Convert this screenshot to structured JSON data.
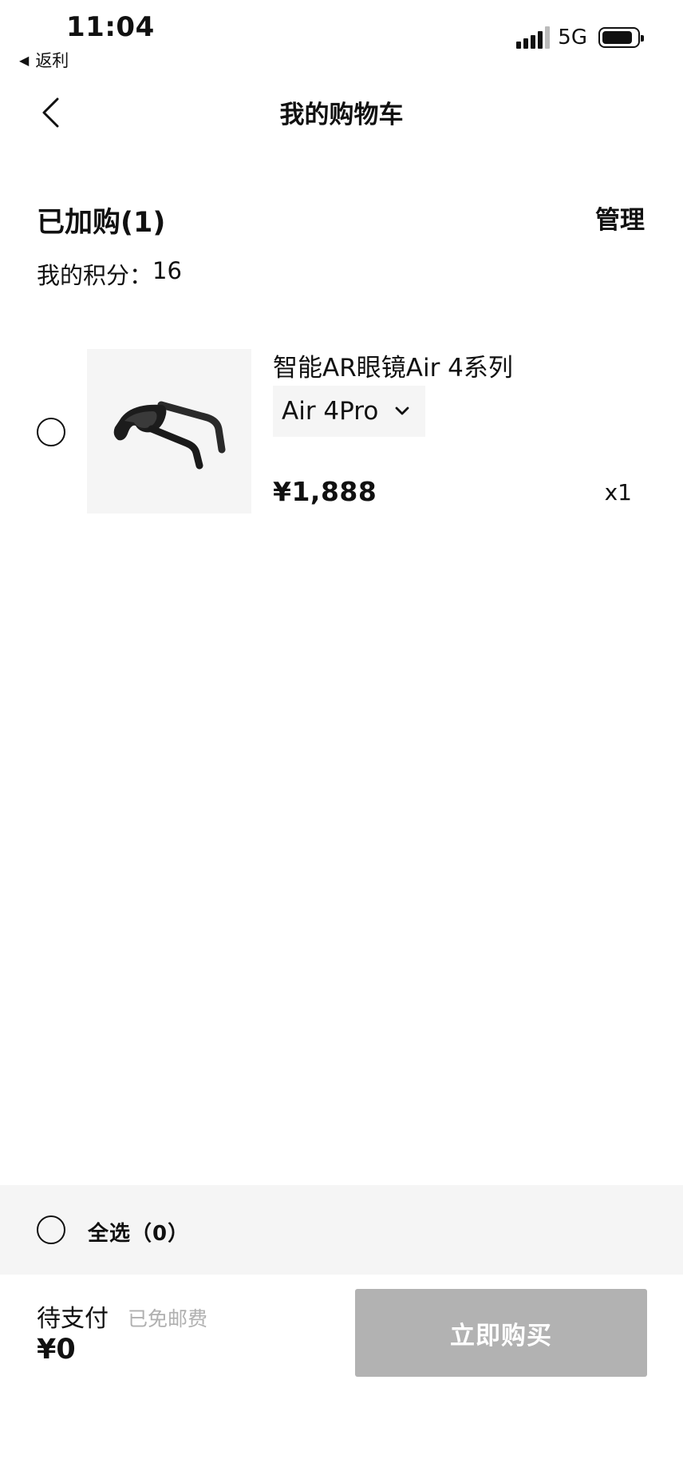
{
  "status_bar": {
    "time": "11:04",
    "back_app": "返利",
    "network": "5G",
    "icons": [
      "signal-icon",
      "battery-icon"
    ]
  },
  "header": {
    "title": "我的购物车",
    "back_icon": "chevron-left-icon"
  },
  "summary": {
    "added_label": "已加购(1)",
    "manage_label": "管理",
    "points_label": "我的积分：",
    "points_value": "16"
  },
  "cart_items": [
    {
      "name": "智能AR眼镜Air 4系列",
      "variant": "Air 4Pro",
      "price": "¥1,888",
      "quantity": "x1",
      "image_icon": "ar-glasses-image",
      "selected": false
    }
  ],
  "select_all": {
    "label": "全选（0）",
    "selected": false
  },
  "footer": {
    "pay_label": "待支付",
    "shipping_note": "已免邮费",
    "total": "¥0",
    "buy_button": "立即购买"
  },
  "colors": {
    "text": "#111111",
    "muted": "#b0b0b0",
    "panel_bg": "#f5f5f5",
    "button_disabled": "#b2b2b2",
    "button_text": "#ffffff"
  }
}
